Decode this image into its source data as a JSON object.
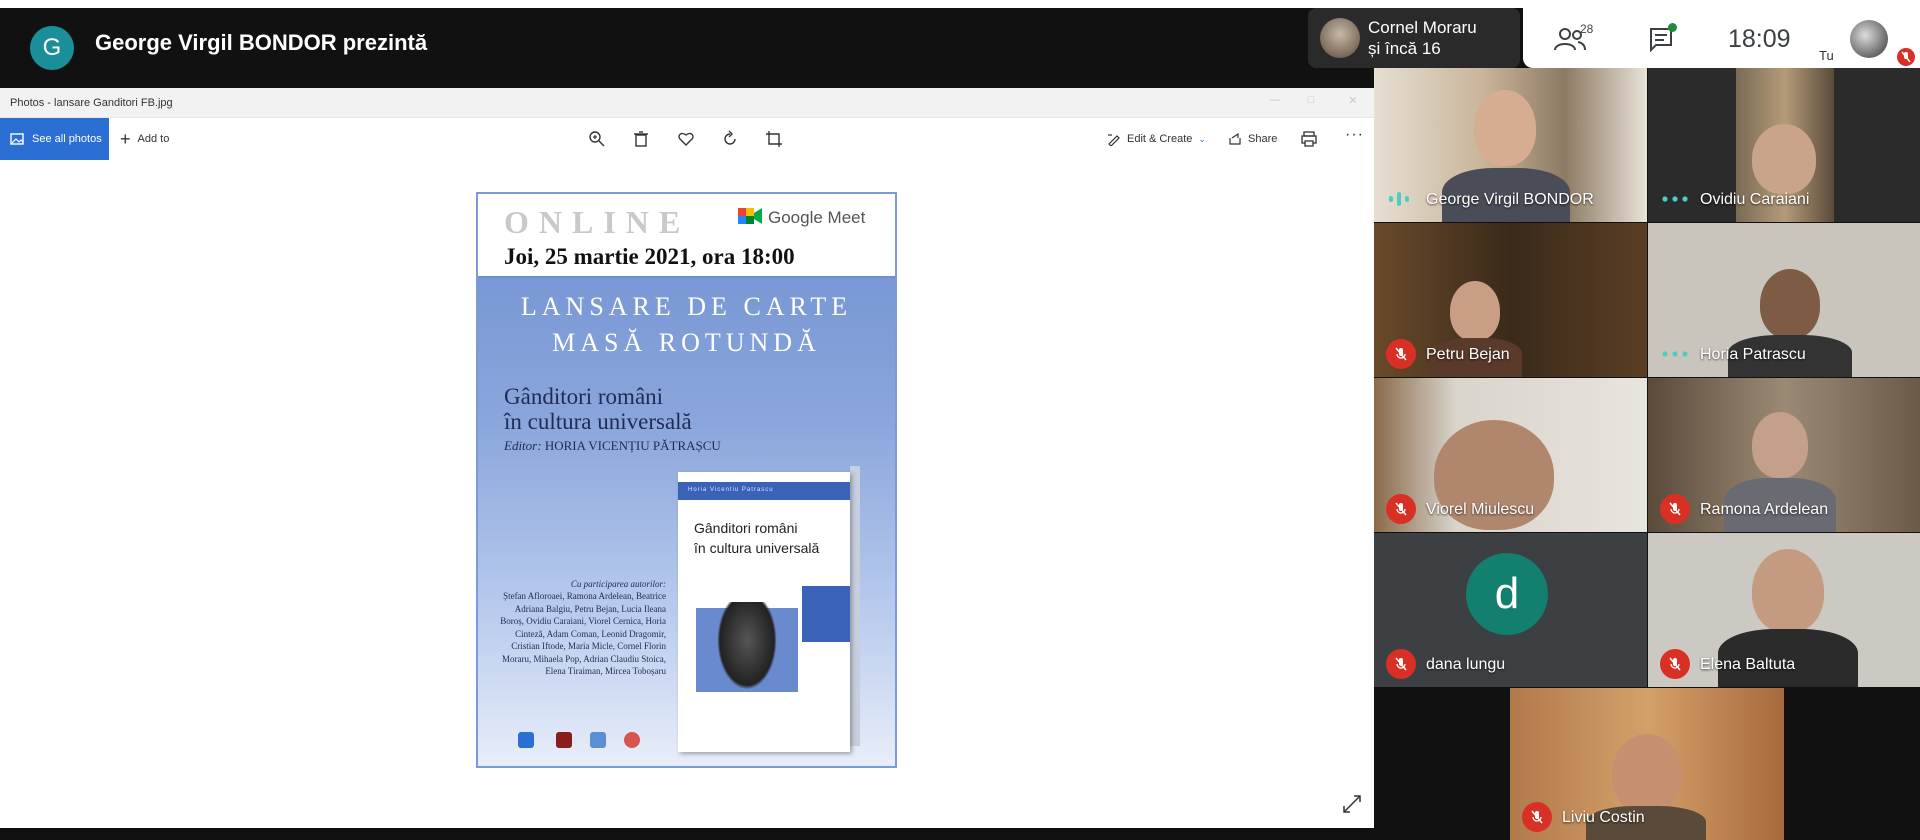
{
  "meet": {
    "presenter_initial": "G",
    "presenting_title": "George Virgil BONDOR prezintă",
    "active_speaker_line1": "Cornel Moraru",
    "active_speaker_line2": "și încă 16",
    "people_count": "28",
    "clock": "18:09",
    "self_label": "Tu"
  },
  "photos": {
    "window_title": "Photos - lansare Ganditori FB.jpg",
    "see_all_label": "See all photos",
    "add_to_label": "Add to",
    "edit_create_label": "Edit & Create",
    "share_label": "Share",
    "more_label": "···"
  },
  "poster": {
    "online": "ONLINE",
    "gmeet": "Google Meet",
    "date": "Joi, 25 martie 2021, ora 18:00",
    "launch_line1": "LANSARE DE CARTE",
    "launch_line2": "MASĂ ROTUNDĂ",
    "book_title_line1": "Gânditori români",
    "book_title_line2": "în cultura universală",
    "editor_prefix": "Editor:",
    "editor_name": "HORIA VICENȚIU PĂTRAȘCU",
    "book_band": "Horia Vicentiu Patrascu",
    "book_cover_line1": "Gânditori români",
    "book_cover_line2": "în cultura universală",
    "participants_head": "Cu participarea autorilor:",
    "participants": "Ștefan Afloroaei, Ramona Ardelean, Beatrice Adriana Balgiu, Petru Bejan, Lucia Ileana Boroș, Ovidiu Caraiani, Viorel Cernica, Horia Cinteză, Adam Coman, Leonid Dragomir, Cristian Iftode, Maria Micle, Cornel Florin Moraru, Mihaela Pop, Adrian Claudiu Stoica, Elena Tiraiman, Mircea Toboșaru"
  },
  "participants": [
    {
      "name": "George Virgil BONDOR",
      "status": "speaking"
    },
    {
      "name": "Ovidiu Caraiani",
      "status": "dots"
    },
    {
      "name": "Petru Bejan",
      "status": "muted"
    },
    {
      "name": "Horia Patrascu",
      "status": "dots"
    },
    {
      "name": "Viorel Miulescu",
      "status": "muted"
    },
    {
      "name": "Ramona Ardelean",
      "status": "muted"
    },
    {
      "name": "dana lungu",
      "status": "muted",
      "initial": "d"
    },
    {
      "name": "Elena Baltuta",
      "status": "muted"
    },
    {
      "name": "Liviu Costin",
      "status": "muted"
    }
  ],
  "colors": {
    "meet_blue_button": "#2b6fd4",
    "mute_red": "#d93025",
    "teal_avatar": "#137f6f",
    "meet_green_dots": "#4ecdc4"
  }
}
